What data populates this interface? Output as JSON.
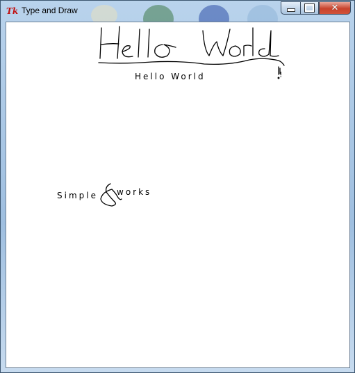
{
  "window": {
    "title": "Type and Draw",
    "app_icon_text": "Tk",
    "app_icon": "tk-feather-icon",
    "controls": {
      "minimize": "minimize-icon",
      "maximize": "maximize-icon",
      "close": "close-icon",
      "close_glyph": "✕"
    }
  },
  "canvas": {
    "typed_text": [
      "Hello World",
      "Simple",
      "works"
    ],
    "handwriting": {
      "words": [
        "Hello World",
        "&"
      ],
      "color": "#000000"
    }
  }
}
